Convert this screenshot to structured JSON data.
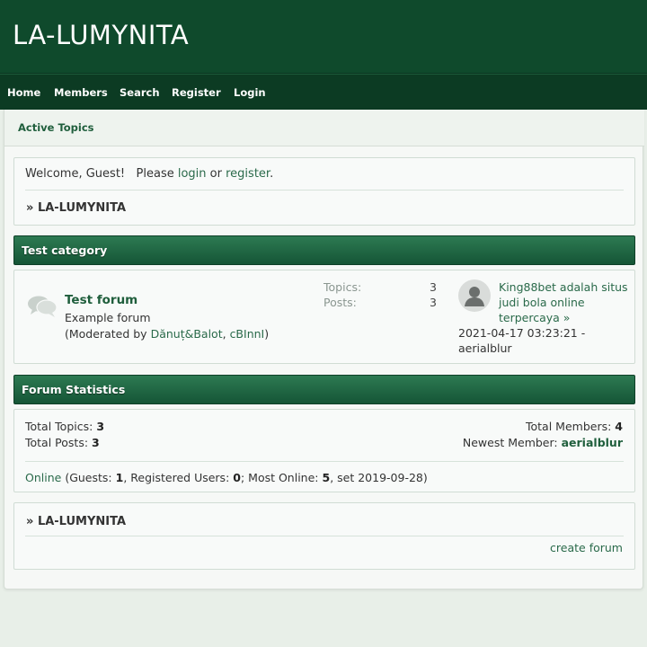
{
  "site": {
    "title": "LA-LUMYNITA"
  },
  "nav": {
    "items": [
      {
        "label": "Home"
      },
      {
        "label": "Members"
      },
      {
        "label": "Search"
      },
      {
        "label": "Register"
      },
      {
        "label": "Login"
      }
    ]
  },
  "subnav": {
    "active_topics": "Active Topics"
  },
  "welcome": {
    "greeting": "Welcome, Guest!",
    "please": "Please",
    "login": "login",
    "or": "or",
    "register": "register",
    "period": ".",
    "breadcrumb_arrow": "»",
    "breadcrumb": "LA-LUMYNITA"
  },
  "category": {
    "title": "Test category",
    "forum": {
      "name": "Test forum",
      "description": "Example forum",
      "moderated_prefix": "(Moderated by",
      "moderators": [
        "Dănuț&Balot",
        "cBInnI"
      ],
      "moderated_suffix": ")",
      "topics_label": "Topics:",
      "topics": "3",
      "posts_label": "Posts:",
      "posts": "3",
      "last_post": {
        "title": "King88bet adalah situs judi bola online terpercaya",
        "arrow": "»",
        "datetime": "2021-04-17 03:23:21",
        "separator": "-",
        "author": "aerialblur"
      }
    }
  },
  "statistics": {
    "title": "Forum Statistics",
    "total_topics_label": "Total Topics:",
    "total_topics": "3",
    "total_posts_label": "Total Posts:",
    "total_posts": "3",
    "total_members_label": "Total Members:",
    "total_members": "4",
    "newest_member_label": "Newest Member:",
    "newest_member": "aerialblur",
    "online_link": "Online",
    "guests_label": "(Guests:",
    "guests": "1",
    "registered_label": ", Registered Users:",
    "registered": "0",
    "most_online_label": "; Most Online:",
    "most_online": "5",
    "most_online_date": ", set 2019-09-28)"
  },
  "footer": {
    "breadcrumb_arrow": "»",
    "breadcrumb": "LA-LUMYNITA",
    "create_forum": "create forum"
  },
  "colors": {
    "header_bg": "#0f4a2c",
    "nav_bg": "#0c3b23",
    "category_bar": "#1e6641",
    "link": "#2a6a4a",
    "page_bg": "#e8efe8"
  }
}
